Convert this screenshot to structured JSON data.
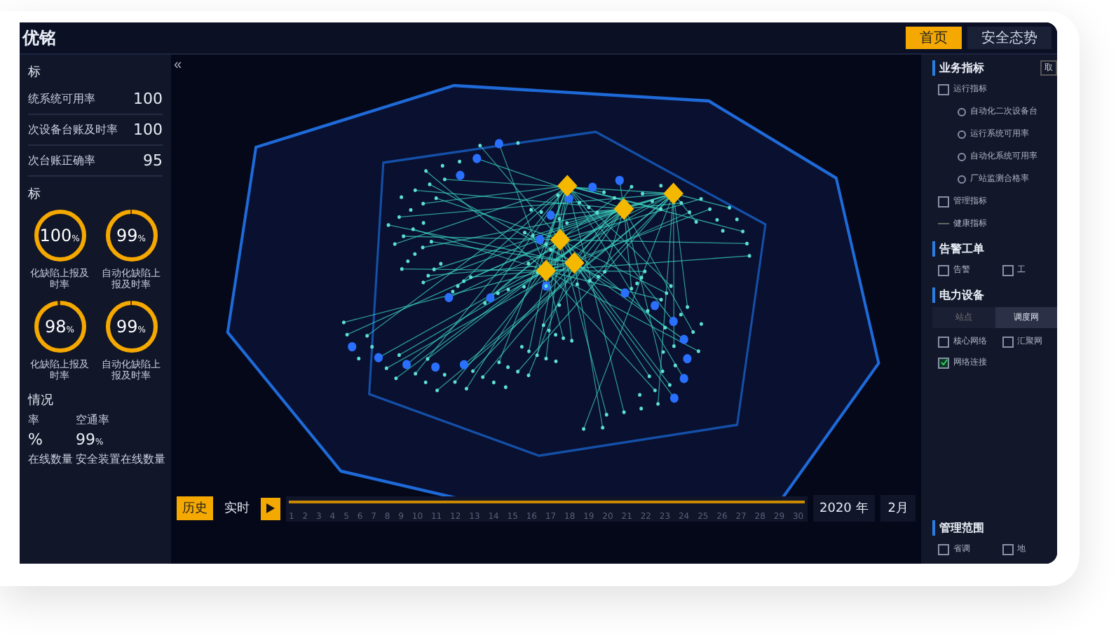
{
  "header": {
    "logo": "优铭",
    "tabs": [
      {
        "label": "首页",
        "selected": true
      },
      {
        "label": "安全态势",
        "selected": false
      }
    ]
  },
  "left_panel": {
    "sections": [
      {
        "title": "标",
        "kind": "rows",
        "rows": [
          {
            "label": "统系统可用率",
            "value": "100"
          },
          {
            "label": "次设备台账及时率",
            "value": "100"
          },
          {
            "label": "次台账正确率",
            "value": "95"
          }
        ]
      },
      {
        "title": "标",
        "kind": "rings",
        "rings": [
          {
            "value": "100",
            "unit": "%",
            "label": "化缺陷上报及时率",
            "level": 1
          },
          {
            "value": "99",
            "unit": "%",
            "label": "自动化缺陷上报及时率",
            "level": 0.99
          },
          {
            "value": "98",
            "unit": "%",
            "label": "化缺陷上报及时率",
            "level": 0.98
          },
          {
            "value": "99",
            "unit": "%",
            "label": "自动化缺陷上报及时率",
            "level": 0.99
          }
        ]
      },
      {
        "title": "情况",
        "kind": "stats",
        "stats": [
          {
            "label": "率",
            "value": "%",
            "footer": "在线数量"
          },
          {
            "label": "空通率",
            "value": "99",
            "unit": "%",
            "footer": "安全装置在线数量"
          }
        ]
      }
    ]
  },
  "map": {
    "collapse": "«"
  },
  "timeline": {
    "modes": [
      {
        "label": "历史",
        "selected": true
      },
      {
        "label": "实时",
        "selected": false
      }
    ],
    "level": 1,
    "ticks": [
      "1",
      "2",
      "3",
      "4",
      "5",
      "6",
      "7",
      "8",
      "9",
      "10",
      "11",
      "12",
      "13",
      "14",
      "15",
      "16",
      "17",
      "18",
      "19",
      "20",
      "21",
      "22",
      "23",
      "24",
      "25",
      "26",
      "27",
      "28",
      "29",
      "30"
    ],
    "year": "2020 年",
    "month": "2月"
  },
  "right_panel": {
    "sections": [
      {
        "title": "业务指标",
        "kind": "tree",
        "action": "取",
        "tree": [
          {
            "label": "运行指标",
            "checked": false,
            "children": [
              {
                "label": "自动化二次设备台"
              },
              {
                "label": "运行系统可用率"
              },
              {
                "label": "自动化系统可用率"
              },
              {
                "label": "厂站监测合格率"
              }
            ]
          },
          {
            "label": "管理指标",
            "checked": false
          },
          {
            "label": "健康指标"
          }
        ]
      },
      {
        "title": "告警工单",
        "kind": "toggles",
        "items": [
          {
            "label": "告警",
            "checked": false
          },
          {
            "label": "工",
            "checked": false
          }
        ]
      },
      {
        "title": "电力设备",
        "kind": "network",
        "tabs": [
          {
            "label": "站点",
            "selected": false
          },
          {
            "label": "调度网",
            "selected": true
          }
        ],
        "items": [
          {
            "label": "核心网络",
            "checked": false
          },
          {
            "label": "汇聚网",
            "checked": false
          },
          {
            "label": "网络连接",
            "checked": true
          }
        ]
      },
      {
        "title": "管理范围",
        "kind": "toggles",
        "items": [
          {
            "label": "省调",
            "checked": false
          },
          {
            "label": "地",
            "checked": false
          }
        ]
      }
    ]
  }
}
